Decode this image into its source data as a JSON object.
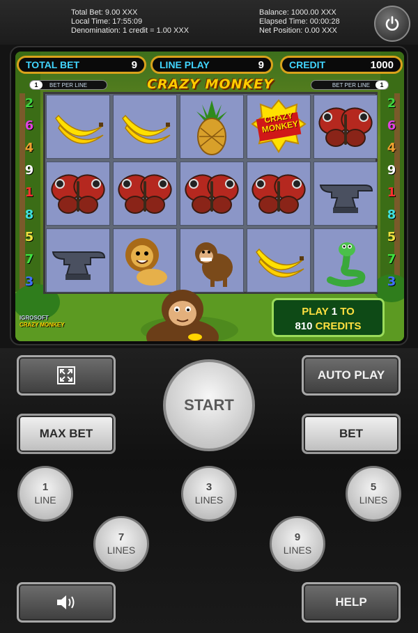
{
  "info": {
    "total_bet": "Total Bet: 9.00 XXX",
    "local_time": "Local Time: 17:55:09",
    "denomination": "Denomination: 1 credit = 1.00 XXX",
    "balance": "Balance: 1000.00 XXX",
    "elapsed": "Elapsed Time: 00:00:28",
    "net_position": "Net Position: 0.00 XXX"
  },
  "hud": {
    "total_bet_label": "TOTAL BET",
    "total_bet_value": "9",
    "line_play_label": "LINE PLAY",
    "line_play_value": "9",
    "credit_label": "CREDIT",
    "credit_value": "1000"
  },
  "game": {
    "title": "CRAZY MONKEY",
    "bet_per_line_label": "BET PER LINE",
    "bet_per_line_value": "1",
    "play_line1_a": "PLAY ",
    "play_line1_b": "1",
    "play_line1_c": " TO",
    "play_line2_a": "810",
    "play_line2_b": " CREDITS",
    "brand_top": "IGROSOFT",
    "brand_bottom": "CRAZY MONKEY",
    "crazy_symbol_text_1": "CRAZY",
    "crazy_symbol_text_2": "MONKEY",
    "line_numbers_left": [
      "2",
      "6",
      "4",
      "9",
      "1",
      "8",
      "5",
      "7",
      "3"
    ],
    "line_numbers_right": [
      "2",
      "6",
      "4",
      "9",
      "1",
      "8",
      "5",
      "7",
      "3"
    ],
    "line_colors": [
      "#3fd23f",
      "#e040e0",
      "#f0a030",
      "#ffffff",
      "#ff3030",
      "#40e0e0",
      "#f0e040",
      "#40e040",
      "#4070ff"
    ],
    "reels": [
      [
        "banana",
        "banana",
        "pineapple",
        "crazy-monkey",
        "butterfly"
      ],
      [
        "butterfly",
        "butterfly",
        "butterfly",
        "butterfly",
        "anvil"
      ],
      [
        "anvil",
        "lion",
        "monkey",
        "banana",
        "snake"
      ]
    ]
  },
  "controls": {
    "fullscreen_icon": "fullscreen-icon",
    "auto_play": "AUTO PLAY",
    "start": "START",
    "max_bet": "MAX BET",
    "bet": "BET",
    "line1_num": "1",
    "line1_lbl": "LINE",
    "line3_num": "3",
    "line3_lbl": "LINES",
    "line5_num": "5",
    "line5_lbl": "LINES",
    "line7_num": "7",
    "line7_lbl": "LINES",
    "line9_num": "9",
    "line9_lbl": "LINES",
    "sound_icon": "speaker-icon",
    "help": "HELP"
  }
}
